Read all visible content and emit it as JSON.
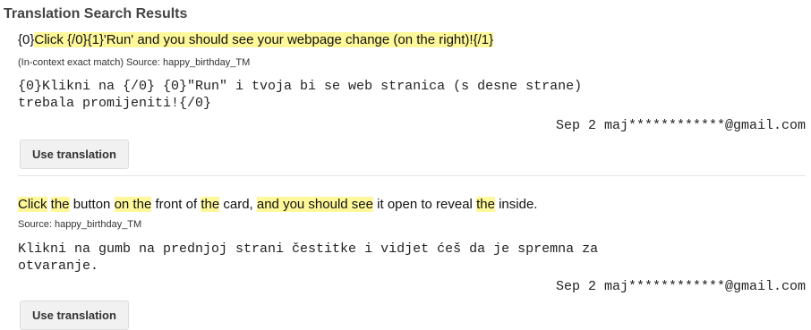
{
  "panel": {
    "title": "Translation Search Results"
  },
  "results": [
    {
      "source_segments": [
        {
          "text": "{0}",
          "highlight": false
        },
        {
          "text": "Click {/0}{1}'Run' and you should see your webpage change (on the right)!{/1}",
          "highlight": true
        }
      ],
      "meta": "(In-context exact match) Source: happy_birthday_TM",
      "translation": "{0}Klikni na {/0} {0}\"Run\" i tvoja bi se web stranica (s desne strane)\ntrebala promijeniti!{/0}",
      "attribution": "Sep 2 maj************@gmail.com",
      "use_button_label": "Use translation"
    },
    {
      "source_segments": [
        {
          "text": "Click",
          "highlight": true
        },
        {
          "text": " ",
          "highlight": false
        },
        {
          "text": "the",
          "highlight": true
        },
        {
          "text": " button ",
          "highlight": false
        },
        {
          "text": "on the",
          "highlight": true
        },
        {
          "text": " front of ",
          "highlight": false
        },
        {
          "text": "the",
          "highlight": true
        },
        {
          "text": " card, ",
          "highlight": false
        },
        {
          "text": "and you should see",
          "highlight": true
        },
        {
          "text": " it open to reveal ",
          "highlight": false
        },
        {
          "text": "the",
          "highlight": true
        },
        {
          "text": " inside.",
          "highlight": false
        }
      ],
      "meta": "Source: happy_birthday_TM",
      "translation": "Klikni na gumb na prednjoj strani čestitke i vidjet ćeš da je spremna za\notvaranje.",
      "attribution": "Sep 2 maj************@gmail.com",
      "use_button_label": "Use translation"
    }
  ],
  "colors": {
    "highlight": "#fff89a",
    "button_bg": "#f1f1f1",
    "title": "#444444"
  }
}
